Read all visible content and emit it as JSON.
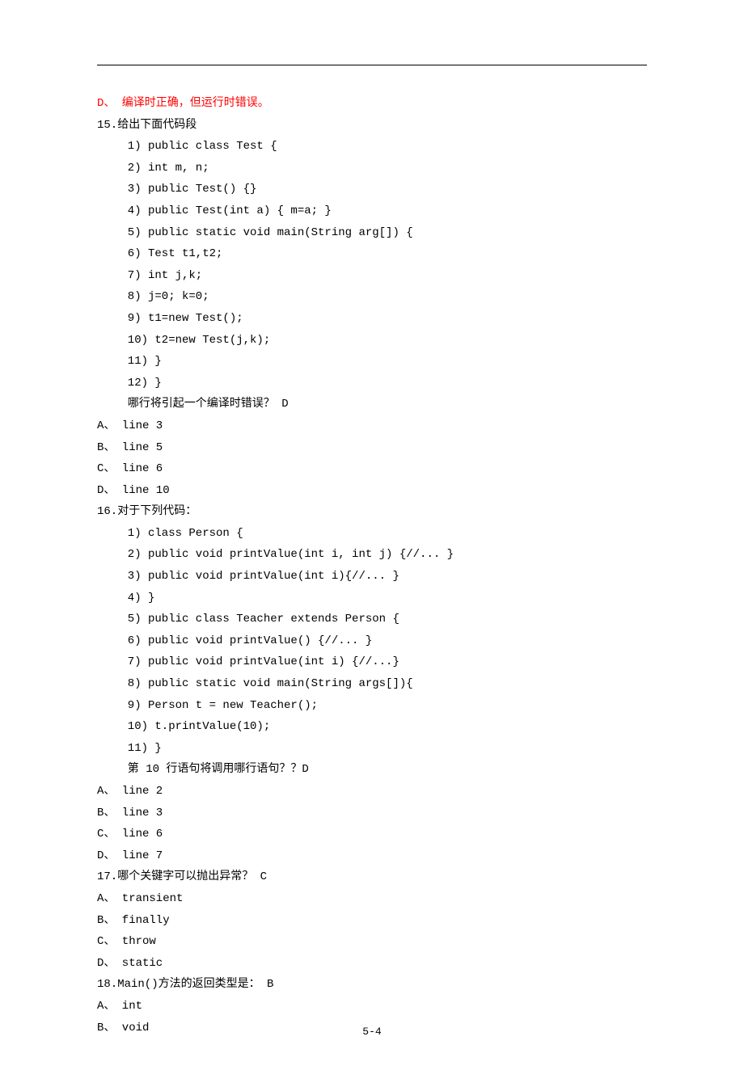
{
  "answerD": "D、 编译时正确，但运行时错误。",
  "q15": {
    "stem": "15.给出下面代码段",
    "code": [
      "1) public class Test {",
      "2) int m, n;",
      "3) public Test() {}",
      "4) public Test(int a) { m=a; }",
      "5) public static void main(String arg[]) {",
      "6) Test t1,t2;",
      "7) int j,k;",
      "8) j=0; k=0;",
      "9) t1=new Test();",
      "10) t2=new Test(j,k);",
      "11) }",
      "12) }"
    ],
    "ask": "哪行将引起一个编译时错误？ D",
    "opts": [
      "A、 line 3",
      "B、 line 5",
      "C、 line 6",
      "D、 line 10"
    ]
  },
  "q16": {
    "stem": "16.对于下列代码：",
    "code": [
      "1) class Person {",
      "2) public void printValue(int i, int j) {//... }",
      "3) public void printValue(int i){//... }",
      "4) }",
      "5) public class Teacher extends Person {",
      "6) public void printValue() {//... }",
      "7) public void printValue(int i) {//...}",
      "8) public static void main(String args[]){",
      "9) Person t = new Teacher();",
      "10) t.printValue(10);",
      "11) }"
    ],
    "ask": "第 10 行语句将调用哪行语句？？D",
    "opts": [
      "A、 line 2",
      "B、 line 3",
      "C、 line 6",
      "D、 line 7"
    ]
  },
  "q17": {
    "stem": "17.哪个关键字可以抛出异常？ C",
    "opts": [
      "A、 transient",
      "B、 finally",
      "C、 throw",
      "D、 static"
    ]
  },
  "q18": {
    "stem": "18.Main()方法的返回类型是： B",
    "opts": [
      "A、 int",
      "B、 void"
    ]
  },
  "footer": "5-4"
}
